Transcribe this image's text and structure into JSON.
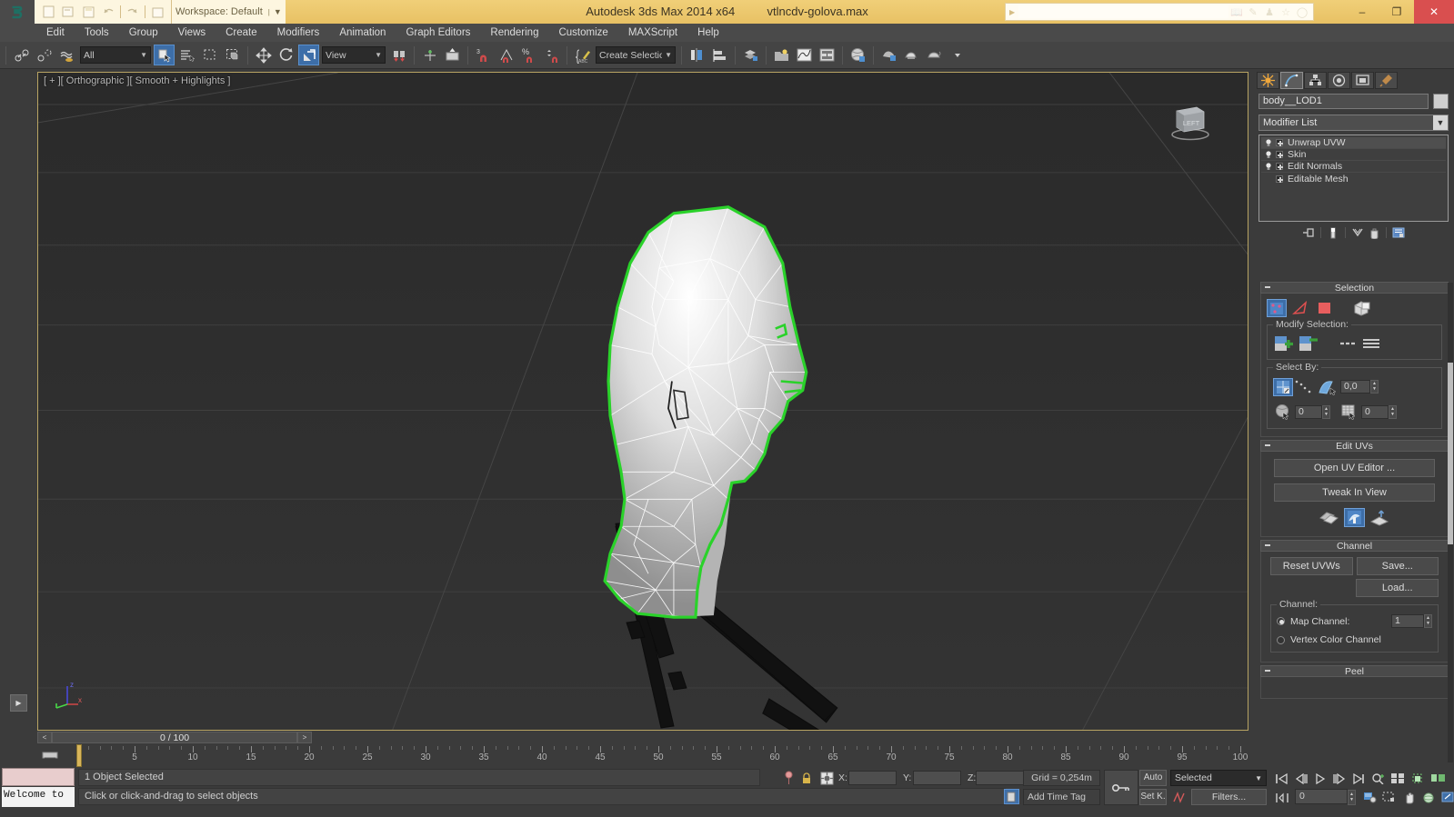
{
  "titlebar": {
    "app_title": "Autodesk 3ds Max  2014 x64",
    "file_name": "vtlncdv-golova.max",
    "workspace_label": "Workspace: Default",
    "minimize": "–",
    "maximize": "❐",
    "close": "✕"
  },
  "menu": {
    "items": [
      "Edit",
      "Tools",
      "Group",
      "Views",
      "Create",
      "Modifiers",
      "Animation",
      "Graph Editors",
      "Rendering",
      "Customize",
      "MAXScript",
      "Help"
    ]
  },
  "toolbar": {
    "selection_filter": "All",
    "reference_coord": "View",
    "named_selection_set": "Create Selection Se"
  },
  "viewport": {
    "label": "[ + ][ Orthographic ][ Smooth + Highlights ]",
    "viewcube_face": "LEFT",
    "axis_x": "x",
    "axis_y": "y",
    "axis_z": "z",
    "expand_arrow": "▶"
  },
  "timeslider": {
    "prev_label": "<",
    "next_label": ">",
    "current": "0 / 100"
  },
  "trackbar": {
    "tick_labels": [
      "5",
      "10",
      "15",
      "20",
      "25",
      "30",
      "35",
      "40",
      "45",
      "50",
      "55",
      "60",
      "65",
      "70",
      "75",
      "80",
      "85",
      "90",
      "95",
      "100"
    ],
    "tick_values": [
      5,
      10,
      15,
      20,
      25,
      30,
      35,
      40,
      45,
      50,
      55,
      60,
      65,
      70,
      75,
      80,
      85,
      90,
      95,
      100
    ],
    "range_start": 0,
    "range_end": 100
  },
  "statusbar": {
    "listener_text": "Welcome to",
    "status_text": "1 Object Selected",
    "prompt_text": "Click or click-and-drag to select objects",
    "x_label": "X:",
    "y_label": "Y:",
    "z_label": "Z:",
    "x_value": "",
    "y_value": "",
    "z_value": "",
    "grid_text": "Grid = 0,254m",
    "add_time_tag": "Add Time Tag",
    "auto_key": "Auto",
    "set_key": "Set K.",
    "key_filter_selected": "Selected",
    "filters_button": "Filters...",
    "frame_field": "0"
  },
  "command_panel": {
    "tabs": [
      "create-tab",
      "modify-tab",
      "hierarchy-tab",
      "motion-tab",
      "display-tab",
      "utilities-tab"
    ],
    "selected_tab_index": 1,
    "object_name": "body__LOD1",
    "modifier_list_label": "Modifier List",
    "stack": [
      {
        "label": "Unwrap UVW",
        "has_bulb": true,
        "highlight": true
      },
      {
        "label": "Skin",
        "has_bulb": true,
        "highlight": false
      },
      {
        "label": "Edit Normals",
        "has_bulb": true,
        "highlight": false
      },
      {
        "label": "Editable Mesh",
        "has_bulb": false,
        "highlight": false
      }
    ],
    "rollouts": {
      "selection": {
        "title": "Selection",
        "modify_selection_label": "Modify Selection:",
        "select_by_label": "Select By:",
        "angle_value": "0,0",
        "smooth_group_value": "0",
        "mat_id_value": "0"
      },
      "edit_uvs": {
        "title": "Edit UVs",
        "open_uv_editor": "Open UV Editor ...",
        "tweak_in_view": "Tweak In View"
      },
      "channel": {
        "title": "Channel",
        "reset_uvws": "Reset UVWs",
        "save": "Save...",
        "load": "Load...",
        "channel_group_label": "Channel:",
        "map_channel_label": "Map Channel:",
        "map_channel_value": "1",
        "vertex_color_label": "Vertex Color Channel",
        "map_channel_selected": true
      },
      "peel": {
        "title": "Peel"
      }
    }
  },
  "colors": {
    "title_bar": "#e8c164",
    "panel_bg": "#3b3b3b",
    "viewport_bg": "#2b2b2b",
    "selection_green": "#2ad22a",
    "accent_blue": "#3d6ea8",
    "close_red": "#d94f4f",
    "wireframe": "#ffffff"
  }
}
